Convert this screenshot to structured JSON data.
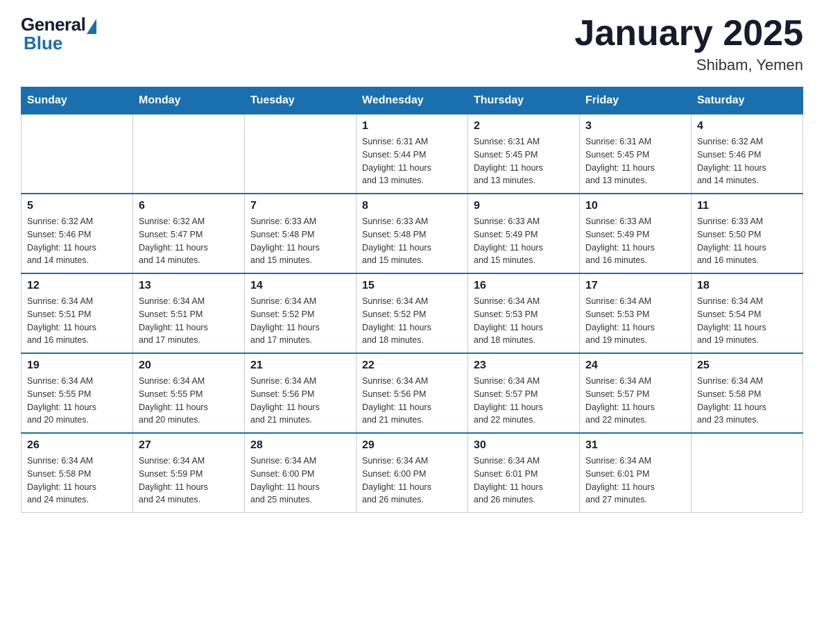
{
  "logo": {
    "general": "General",
    "blue": "Blue"
  },
  "title": "January 2025",
  "subtitle": "Shibam, Yemen",
  "days": [
    "Sunday",
    "Monday",
    "Tuesday",
    "Wednesday",
    "Thursday",
    "Friday",
    "Saturday"
  ],
  "weeks": [
    [
      {
        "day": "",
        "info": ""
      },
      {
        "day": "",
        "info": ""
      },
      {
        "day": "",
        "info": ""
      },
      {
        "day": "1",
        "info": "Sunrise: 6:31 AM\nSunset: 5:44 PM\nDaylight: 11 hours\nand 13 minutes."
      },
      {
        "day": "2",
        "info": "Sunrise: 6:31 AM\nSunset: 5:45 PM\nDaylight: 11 hours\nand 13 minutes."
      },
      {
        "day": "3",
        "info": "Sunrise: 6:31 AM\nSunset: 5:45 PM\nDaylight: 11 hours\nand 13 minutes."
      },
      {
        "day": "4",
        "info": "Sunrise: 6:32 AM\nSunset: 5:46 PM\nDaylight: 11 hours\nand 14 minutes."
      }
    ],
    [
      {
        "day": "5",
        "info": "Sunrise: 6:32 AM\nSunset: 5:46 PM\nDaylight: 11 hours\nand 14 minutes."
      },
      {
        "day": "6",
        "info": "Sunrise: 6:32 AM\nSunset: 5:47 PM\nDaylight: 11 hours\nand 14 minutes."
      },
      {
        "day": "7",
        "info": "Sunrise: 6:33 AM\nSunset: 5:48 PM\nDaylight: 11 hours\nand 15 minutes."
      },
      {
        "day": "8",
        "info": "Sunrise: 6:33 AM\nSunset: 5:48 PM\nDaylight: 11 hours\nand 15 minutes."
      },
      {
        "day": "9",
        "info": "Sunrise: 6:33 AM\nSunset: 5:49 PM\nDaylight: 11 hours\nand 15 minutes."
      },
      {
        "day": "10",
        "info": "Sunrise: 6:33 AM\nSunset: 5:49 PM\nDaylight: 11 hours\nand 16 minutes."
      },
      {
        "day": "11",
        "info": "Sunrise: 6:33 AM\nSunset: 5:50 PM\nDaylight: 11 hours\nand 16 minutes."
      }
    ],
    [
      {
        "day": "12",
        "info": "Sunrise: 6:34 AM\nSunset: 5:51 PM\nDaylight: 11 hours\nand 16 minutes."
      },
      {
        "day": "13",
        "info": "Sunrise: 6:34 AM\nSunset: 5:51 PM\nDaylight: 11 hours\nand 17 minutes."
      },
      {
        "day": "14",
        "info": "Sunrise: 6:34 AM\nSunset: 5:52 PM\nDaylight: 11 hours\nand 17 minutes."
      },
      {
        "day": "15",
        "info": "Sunrise: 6:34 AM\nSunset: 5:52 PM\nDaylight: 11 hours\nand 18 minutes."
      },
      {
        "day": "16",
        "info": "Sunrise: 6:34 AM\nSunset: 5:53 PM\nDaylight: 11 hours\nand 18 minutes."
      },
      {
        "day": "17",
        "info": "Sunrise: 6:34 AM\nSunset: 5:53 PM\nDaylight: 11 hours\nand 19 minutes."
      },
      {
        "day": "18",
        "info": "Sunrise: 6:34 AM\nSunset: 5:54 PM\nDaylight: 11 hours\nand 19 minutes."
      }
    ],
    [
      {
        "day": "19",
        "info": "Sunrise: 6:34 AM\nSunset: 5:55 PM\nDaylight: 11 hours\nand 20 minutes."
      },
      {
        "day": "20",
        "info": "Sunrise: 6:34 AM\nSunset: 5:55 PM\nDaylight: 11 hours\nand 20 minutes."
      },
      {
        "day": "21",
        "info": "Sunrise: 6:34 AM\nSunset: 5:56 PM\nDaylight: 11 hours\nand 21 minutes."
      },
      {
        "day": "22",
        "info": "Sunrise: 6:34 AM\nSunset: 5:56 PM\nDaylight: 11 hours\nand 21 minutes."
      },
      {
        "day": "23",
        "info": "Sunrise: 6:34 AM\nSunset: 5:57 PM\nDaylight: 11 hours\nand 22 minutes."
      },
      {
        "day": "24",
        "info": "Sunrise: 6:34 AM\nSunset: 5:57 PM\nDaylight: 11 hours\nand 22 minutes."
      },
      {
        "day": "25",
        "info": "Sunrise: 6:34 AM\nSunset: 5:58 PM\nDaylight: 11 hours\nand 23 minutes."
      }
    ],
    [
      {
        "day": "26",
        "info": "Sunrise: 6:34 AM\nSunset: 5:58 PM\nDaylight: 11 hours\nand 24 minutes."
      },
      {
        "day": "27",
        "info": "Sunrise: 6:34 AM\nSunset: 5:59 PM\nDaylight: 11 hours\nand 24 minutes."
      },
      {
        "day": "28",
        "info": "Sunrise: 6:34 AM\nSunset: 6:00 PM\nDaylight: 11 hours\nand 25 minutes."
      },
      {
        "day": "29",
        "info": "Sunrise: 6:34 AM\nSunset: 6:00 PM\nDaylight: 11 hours\nand 26 minutes."
      },
      {
        "day": "30",
        "info": "Sunrise: 6:34 AM\nSunset: 6:01 PM\nDaylight: 11 hours\nand 26 minutes."
      },
      {
        "day": "31",
        "info": "Sunrise: 6:34 AM\nSunset: 6:01 PM\nDaylight: 11 hours\nand 27 minutes."
      },
      {
        "day": "",
        "info": ""
      }
    ]
  ]
}
